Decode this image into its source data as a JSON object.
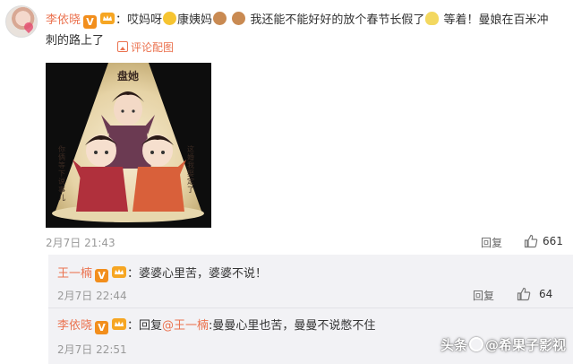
{
  "post": {
    "author": "李依晓",
    "verified_badge": "V",
    "text_line1_a": "：哎妈呀",
    "text_line1_b": "康姨妈",
    "text_line1_c": "我还能不能好好的放个春节长假了",
    "text_line1_d": "等着！曼娘在百米冲",
    "text_line2": "刺的路上了",
    "comment_with_pic_label": "评论配图",
    "image_title_glyphs": "盘她",
    "image_side_text_left": "你俩等下说事儿",
    "image_side_text_right": "这婚我娶定了",
    "timestamp": "2月7日 21:43",
    "reply_label": "回复",
    "likes": "661"
  },
  "replies": [
    {
      "author": "王一楠",
      "verified_badge": "V",
      "text": "：婆婆心里苦，婆婆不说！",
      "timestamp": "2月7日 22:44",
      "reply_label": "回复",
      "likes": "64"
    },
    {
      "author": "李依晓",
      "verified_badge": "V",
      "text_prefix": "：回复",
      "mention": "@王一楠",
      "text_suffix": ":曼曼心里也苦，曼曼不说憋不住",
      "timestamp": "2月7日 22:51"
    }
  ],
  "watermark": {
    "prefix": "头条",
    "suffix": "@希果子影视"
  },
  "colors": {
    "accent": "#eb7350",
    "badge": "#f28e1c",
    "reply_bg": "#f2f2f5"
  }
}
